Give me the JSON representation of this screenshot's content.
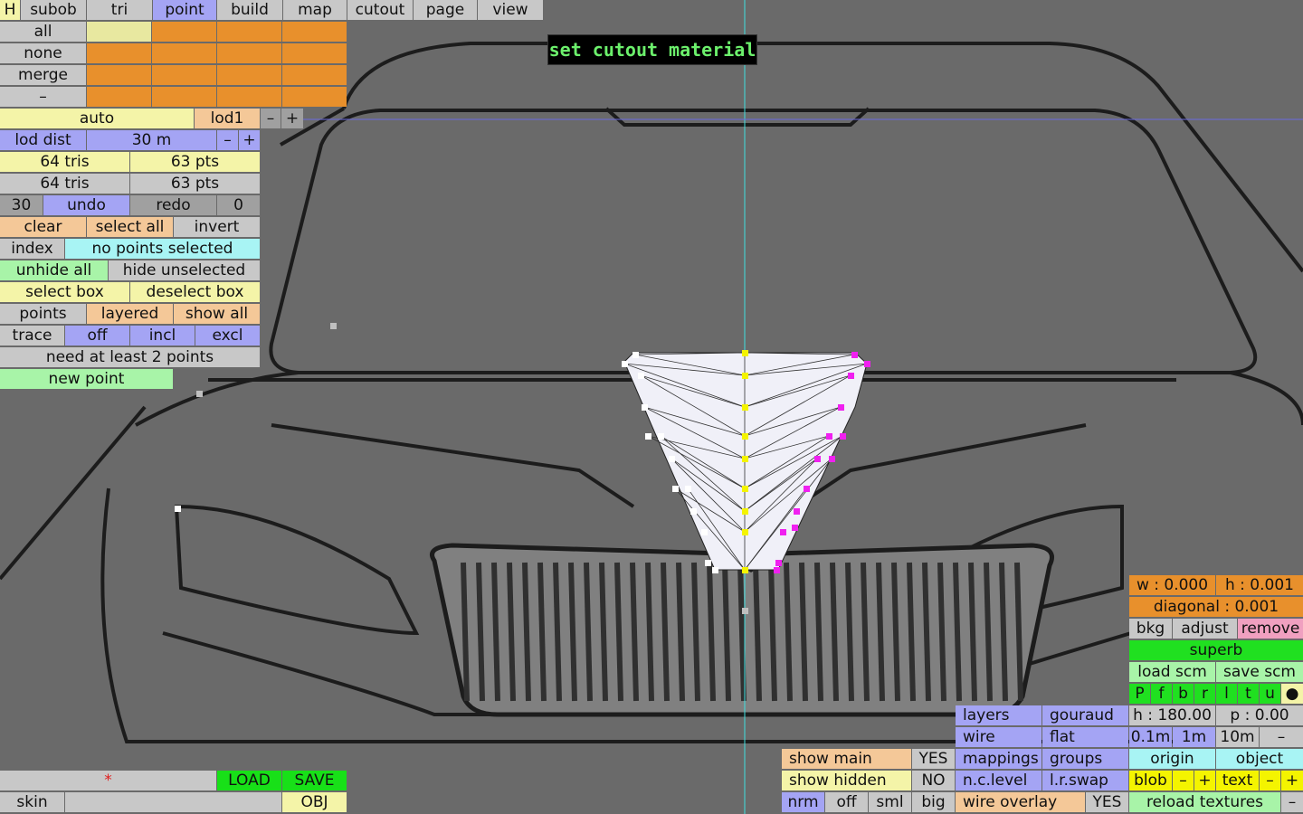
{
  "menu": [
    "H",
    "subob",
    "tri",
    "point",
    "build",
    "map",
    "cutout",
    "page",
    "view"
  ],
  "status_banner": "set cutout material",
  "selection_rows": [
    "all",
    "none",
    "merge",
    "–"
  ],
  "lod": {
    "mode": "auto",
    "level": "lod1",
    "minus": "–",
    "plus": "+",
    "dist_label": "lod dist",
    "dist_value": "30 m"
  },
  "stats": {
    "tris_a": "64 tris",
    "pts_a": "63 pts",
    "tris_b": "64 tris",
    "pts_b": "63 pts"
  },
  "history": {
    "count": "30",
    "undo": "undo",
    "redo": "redo",
    "redo_count": "0"
  },
  "actions": {
    "clear": "clear",
    "select_all": "select all",
    "invert": "invert",
    "index": "index",
    "index_status": "no points selected",
    "unhide_all": "unhide all",
    "hide_unselected": "hide unselected",
    "select_box": "select box",
    "deselect_box": "deselect box",
    "points": "points",
    "layered": "layered",
    "show_all": "show all",
    "trace": "trace",
    "off": "off",
    "incl": "incl",
    "excl": "excl",
    "trace_status": "need at least 2 points",
    "new_point": "new point"
  },
  "file": {
    "modified_mark": "*",
    "load": "LOAD",
    "save": "SAVE",
    "skin": "skin",
    "obj": "OBJ"
  },
  "display": {
    "show_main": "show main",
    "show_main_val": "YES",
    "show_hidden": "show hidden",
    "show_hidden_val": "NO",
    "nrm": "nrm",
    "off": "off",
    "sml": "sml",
    "big": "big"
  },
  "render": {
    "layers": "layers",
    "gouraud": "gouraud",
    "wire": "wire",
    "flat": "flat",
    "mappings": "mappings",
    "groups": "groups",
    "nc_level": "n.c.level",
    "lr_swap": "l.r.swap",
    "wire_overlay": "wire overlay",
    "wire_overlay_val": "YES"
  },
  "bkg": {
    "w": "w : 0.000",
    "h": "h : 0.001",
    "diagonal": "diagonal : 0.001",
    "bkg": "bkg",
    "adjust": "adjust",
    "remove": "remove",
    "superb": "superb",
    "load_scm": "load scm",
    "save_scm": "save scm",
    "flags": [
      "P",
      "f",
      "b",
      "r",
      "l",
      "t",
      "u",
      "●"
    ],
    "heading": "h : 180.00",
    "pitch": "p : 0.00",
    "step1": "0.1m",
    "step2": "1m",
    "step3": "10m",
    "step_minus": "–",
    "origin": "origin",
    "object": "object",
    "blob": "blob",
    "minus": "–",
    "plus": "+",
    "text": "text",
    "reload": "reload textures",
    "reload_minus": "–"
  },
  "colors": {
    "mesh_fill": "#f0f0f8",
    "mid_points": "#f4f400",
    "selected_points": "#f020f0",
    "guide_line": "#40e0e0"
  }
}
